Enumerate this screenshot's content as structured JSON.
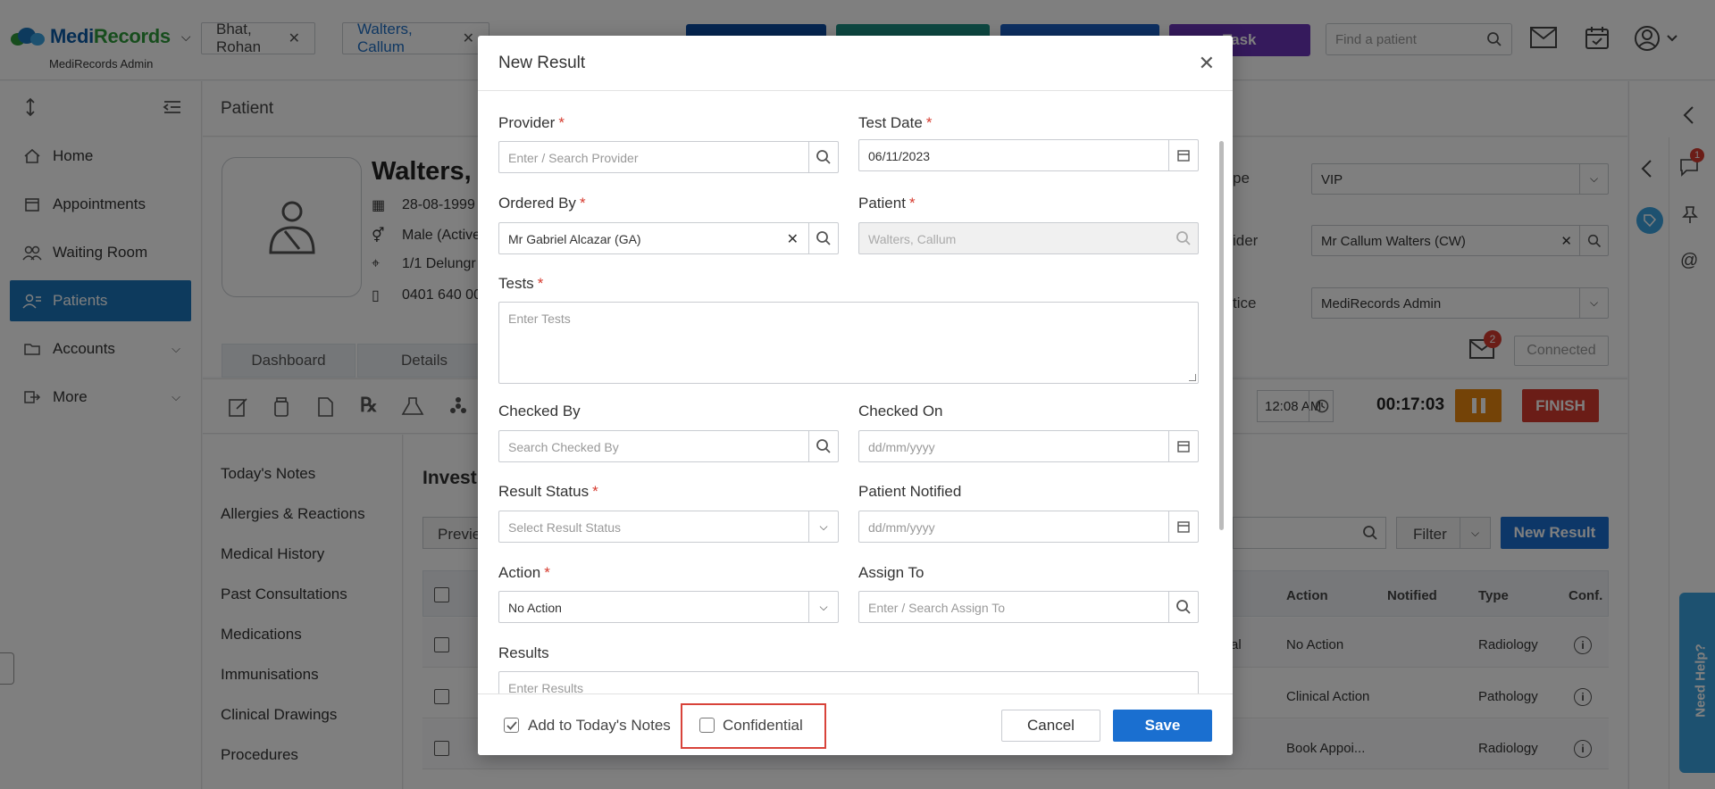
{
  "app": {
    "brand": "MediRecords",
    "brand_sub": "MediRecords Admin"
  },
  "header": {
    "patient_tabs": [
      {
        "label": "Bhat, Rohan"
      },
      {
        "label": "Walters, Callum"
      }
    ],
    "task_label": "Task",
    "find_placeholder": "Find a patient",
    "button_colors": [
      "#0a4aa0",
      "#1a8f82",
      "#1a5fc2",
      "#6a35b8"
    ]
  },
  "sidebar": {
    "items": [
      {
        "label": "Home",
        "icon": "home-icon"
      },
      {
        "label": "Appointments",
        "icon": "calendar-icon"
      },
      {
        "label": "Waiting Room",
        "icon": "people-icon"
      },
      {
        "label": "Patients",
        "icon": "patients-icon",
        "active": true
      },
      {
        "label": "Accounts",
        "icon": "folder-icon",
        "expandable": true
      },
      {
        "label": "More",
        "icon": "more-icon",
        "expandable": true
      }
    ]
  },
  "main": {
    "header_title": "Patient",
    "patient": {
      "name": "Walters,",
      "dob": "28-08-1999 (",
      "gender": "Male (Active",
      "address": "1/1 Delungr",
      "phone": "0401 640 00"
    },
    "right_fields": [
      {
        "label": "pe",
        "value": "VIP"
      },
      {
        "label": "ider",
        "value": "Mr Callum Walters (CW)"
      },
      {
        "label": "tice",
        "value": "MediRecords Admin"
      }
    ],
    "mail_badge": "2",
    "connected_label": "Connected",
    "tabs": [
      {
        "label": "Dashboard"
      },
      {
        "label": "Details"
      }
    ],
    "time_value": "12:08 AM",
    "timer": "00:17:03",
    "finish_label": "FINISH",
    "subnav": [
      "Today's Notes",
      "Allergies & Reactions",
      "Medical History",
      "Past Consultations",
      "Medications",
      "Immunisations",
      "Clinical Drawings",
      "Procedures"
    ],
    "content_title": "Investi",
    "preview_label": "Previe",
    "filter_label": "Filter",
    "new_result_label": "New Result",
    "table": {
      "headers": [
        "Action",
        "Notified",
        "Type",
        "Conf."
      ],
      "rows": [
        {
          "partial": "al",
          "action": "No Action",
          "notified": "",
          "type": "Radiology"
        },
        {
          "partial": "",
          "action": "Clinical Action",
          "notified": "",
          "type": "Pathology"
        },
        {
          "partial": "",
          "action": "Book Appoi...",
          "notified": "",
          "type": "Radiology"
        }
      ]
    },
    "notification_badge": "1",
    "need_help": "Need Help?"
  },
  "modal": {
    "title": "New Result",
    "provider": {
      "label": "Provider",
      "placeholder": "Enter / Search Provider"
    },
    "test_date": {
      "label": "Test Date",
      "value": "06/11/2023"
    },
    "ordered_by": {
      "label": "Ordered By",
      "value": "Mr Gabriel Alcazar (GA)"
    },
    "patient": {
      "label": "Patient",
      "value": "Walters, Callum"
    },
    "tests": {
      "label": "Tests",
      "placeholder": "Enter Tests"
    },
    "checked_by": {
      "label": "Checked By",
      "placeholder": "Search Checked By"
    },
    "checked_on": {
      "label": "Checked On",
      "placeholder": "dd/mm/yyyy"
    },
    "result_status": {
      "label": "Result Status",
      "placeholder": "Select Result Status"
    },
    "patient_notified": {
      "label": "Patient Notified",
      "placeholder": "dd/mm/yyyy"
    },
    "action": {
      "label": "Action",
      "value": "No Action"
    },
    "assign_to": {
      "label": "Assign To",
      "placeholder": "Enter / Search Assign To"
    },
    "results": {
      "label": "Results",
      "placeholder": "Enter Results"
    },
    "add_to_notes": {
      "label": "Add to Today's Notes",
      "checked": true
    },
    "confidential": {
      "label": "Confidential",
      "checked": false
    },
    "cancel_label": "Cancel",
    "save_label": "Save"
  }
}
